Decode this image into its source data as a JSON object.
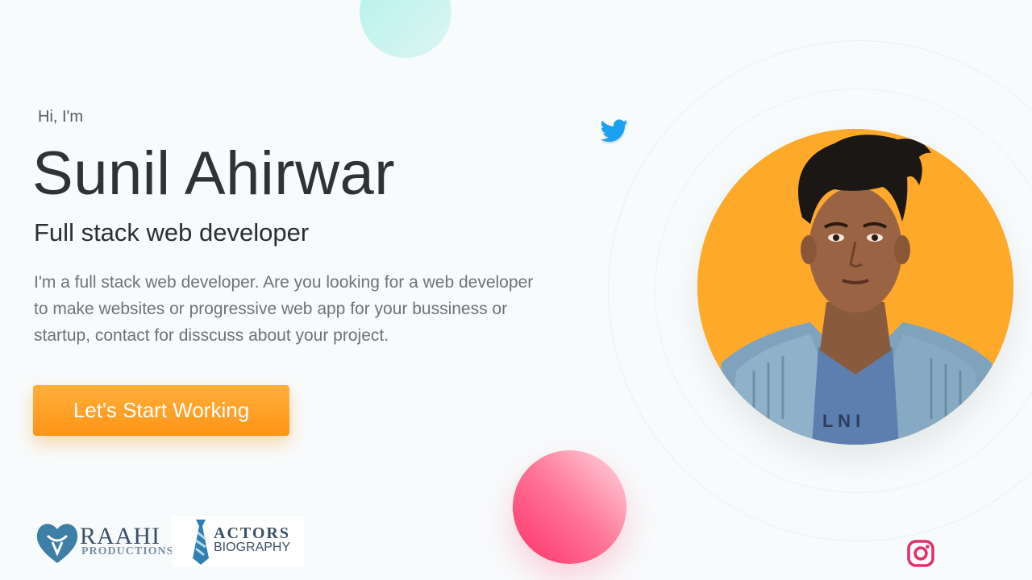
{
  "hero": {
    "greeting": "Hi, I'm",
    "name": "Sunil Ahirwar",
    "role": "Full stack web developer",
    "description": "I'm a full stack web developer. Are you looking for a web developer to make websites or progressive web app for your bussiness or startup, contact for disscuss about your project.",
    "cta_label": "Let's Start Working"
  },
  "social": {
    "twitter_icon": "twitter-icon",
    "instagram_icon": "instagram-icon"
  },
  "logos": {
    "raahi": {
      "line1": "RAAHI",
      "line2": "PRODUCTIONS"
    },
    "actors": {
      "line1": "ACTORS",
      "line2": "BIOGRAPHY"
    }
  },
  "colors": {
    "accent": "#ff9f22",
    "avatar_bg": "#ffa92b",
    "twitter": "#1da1f2",
    "instagram": "#e1306c",
    "pink_bubble": "#ff4a7d",
    "teal_bubble": "#c6f3ee"
  }
}
